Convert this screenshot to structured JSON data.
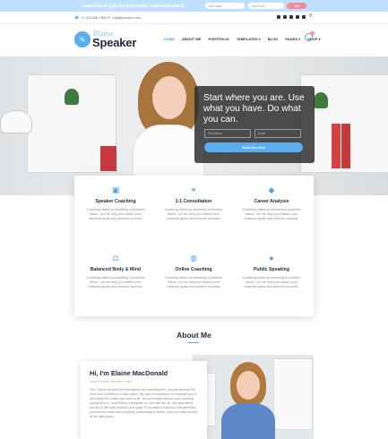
{
  "topbar": {
    "text": "Subscribe to grab my Successful Leadership eBook",
    "name_placeholder": "Your Name",
    "email_placeholder": "Your Email",
    "join_label": "Join"
  },
  "contact": {
    "phone": "+1 123-456-7890",
    "email": "mail@domain.com"
  },
  "logo": {
    "script": "Elaine",
    "main": "Speaker"
  },
  "nav": {
    "items": [
      "HOME",
      "ABOUT ME",
      "PORTFOLIO",
      "TEMPLATES ▾",
      "BLOG",
      "PAGES ▾",
      "SHOP ▾"
    ],
    "cart_count": "0"
  },
  "hero": {
    "cta_title": "Start where you are. Use what you have. Do what you can.",
    "first_name_placeholder": "First Name",
    "email_placeholder": "Email",
    "button_label": "Subscribe Now"
  },
  "services": [
    {
      "title": "Speaker Coaching",
      "icon": "briefcase-icon",
      "desc": "Coaching starts by declaring a powerful future. Let me help you realize your business goals and achieve success."
    },
    {
      "title": "1:1 Consultation",
      "icon": "handshake-icon",
      "desc": "Coaching starts by declaring a powerful future. Let me help you realize your business goals and achieve success."
    },
    {
      "title": "Career Analysis",
      "icon": "graduation-cap-icon",
      "desc": "Coaching starts by declaring a powerful future. Let me help you realize your business goals and achieve success."
    },
    {
      "title": "Balanced Body & Mind",
      "icon": "balance-scale-icon",
      "desc": "Coaching starts by declaring a powerful future. Let me help you realize your business goals and achieve success."
    },
    {
      "title": "Online Coaching",
      "icon": "globe-icon",
      "desc": "Coaching starts by declaring a powerful future. Let me help you realize your business goals and achieve success."
    },
    {
      "title": "Public Speaking",
      "icon": "map-pin-icon",
      "desc": "Coaching starts by declaring a powerful future. Let me help you realize your business goals and achieve success."
    }
  ],
  "about": {
    "title": "About Me",
    "heading": "Hi, I'm Elaine MacDonald",
    "subtitle": "Owner/Founder, Executive Coach",
    "body": "Yes, I know my stuff! And throughout our coaching time, you will develop the tools and confidence to take action. My way of coaching is to empower you in becoming the Leader you want to be. You are unique and so your coaching should be too. I don't follow a template, or 'one size fits all'. We start where you are & we work towards your goals. If you want a business that generates your income while also positively contributing to others, then you have arrived at the right place!"
  },
  "colors": {
    "accent": "#5aaef0",
    "topbar": "#bfe1ff",
    "join": "#f38a9b",
    "dark": "#1c2b3a"
  }
}
